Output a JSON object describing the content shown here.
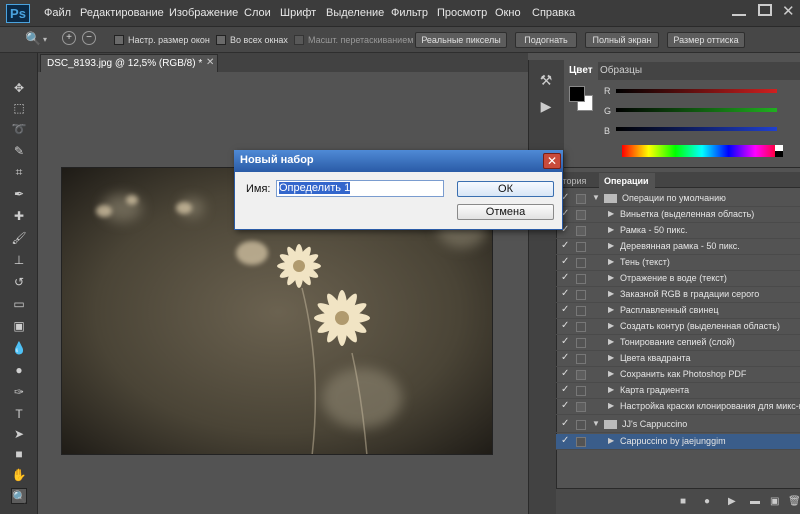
{
  "app": {
    "logo": "Ps"
  },
  "menu": [
    "Файл",
    "Редактирование",
    "Изображение",
    "Слои",
    "Шрифт",
    "Выделение",
    "Фильтр",
    "Просмотр",
    "Окно",
    "Справка"
  ],
  "options": {
    "resize_windows": "Настр. размер окон",
    "all_windows": "Во всех окнах",
    "scrubby_zoom": "Масшт. перетаскиванием",
    "actual_pixels": "Реальные пикселы",
    "fit_screen": "Подогнать",
    "fill_screen": "Полный экран",
    "print_size": "Размер оттиска"
  },
  "document": {
    "tab_title": "DSC_8193.jpg @ 12,5% (RGB/8) *"
  },
  "color_panel": {
    "tab_color": "Цвет",
    "tab_swatches": "Образцы",
    "channels": [
      {
        "label": "R",
        "color": "#d02020"
      },
      {
        "label": "G",
        "color": "#20b020"
      },
      {
        "label": "B",
        "color": "#2040d0"
      }
    ]
  },
  "actions_panel": {
    "tab_history": "стория",
    "tab_actions": "Операции",
    "items": [
      "Операции по умолчанию",
      "Виньетка (выделенная область)",
      "Рамка - 50 пикс.",
      "Деревянная рамка - 50 пикс.",
      "Тень (текст)",
      "Отражение в воде (текст)",
      "Заказной RGB в градации серого",
      "Расплавленный свинец",
      "Создать контур (выделенная область)",
      "Тонирование сепией (слой)",
      "Цвета квадранта",
      "Сохранить как Photoshop PDF",
      "Карта градиента",
      "Настройка краски клонирования для микс-кисти",
      "JJ's Cappuccino",
      "Cappuccino by jaejunggim"
    ]
  },
  "dialog": {
    "title": "Новый набор",
    "name_label": "Имя:",
    "name_value": "Определить 1",
    "ok_label": "ОК",
    "cancel_label": "Отмена"
  }
}
